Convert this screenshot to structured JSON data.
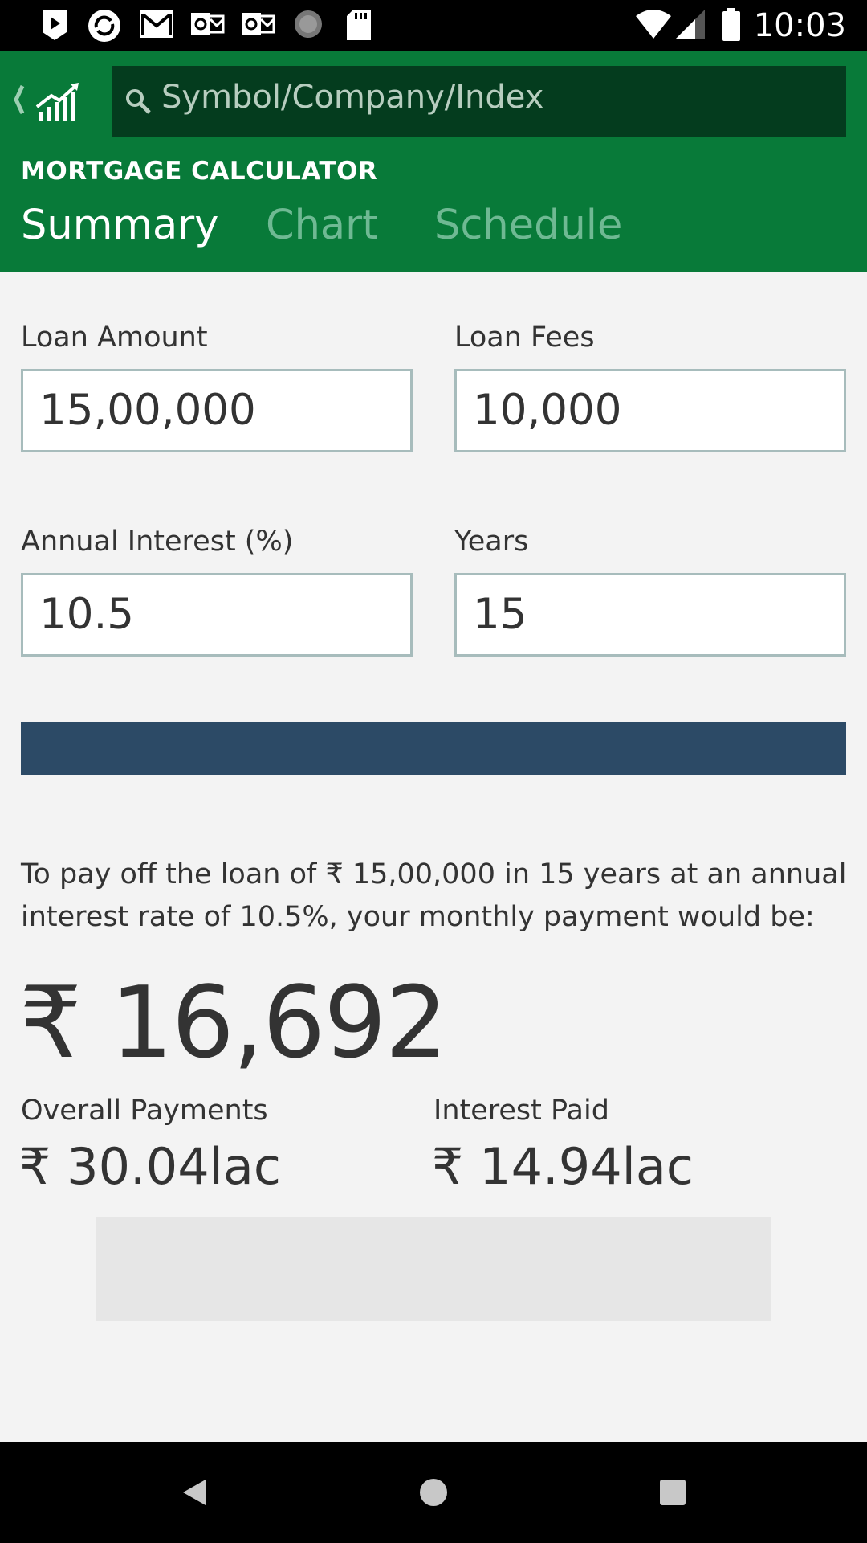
{
  "status_bar": {
    "time": "10:03",
    "icons": [
      "play-store-icon",
      "sync-icon",
      "gmail-icon",
      "outlook-icon",
      "outlook-icon",
      "loading-icon",
      "sd-card-icon",
      "wifi-icon",
      "signal-icon",
      "battery-icon"
    ]
  },
  "header": {
    "search_placeholder": "Symbol/Company/Index",
    "section_title": "MORTGAGE CALCULATOR",
    "tabs": [
      {
        "label": "Summary",
        "active": true
      },
      {
        "label": "Chart",
        "active": false
      },
      {
        "label": "Schedule",
        "active": false
      }
    ]
  },
  "form": {
    "loan_amount": {
      "label": "Loan Amount",
      "value": "15,00,000"
    },
    "loan_fees": {
      "label": "Loan Fees",
      "value": "10,000"
    },
    "annual_interest": {
      "label": "Annual Interest (%)",
      "value": "10.5"
    },
    "years": {
      "label": "Years",
      "value": "15"
    }
  },
  "result": {
    "summary": "To pay off the loan of ₹ 15,00,000 in 15 years at an annual interest rate of 10.5%, your monthly payment would be:",
    "monthly_payment": "₹ 16,692",
    "overall_payments": {
      "label": "Overall Payments",
      "value": "₹ 30.04lac"
    },
    "interest_paid": {
      "label": "Interest Paid",
      "value": "₹ 14.94lac"
    }
  },
  "colors": {
    "header_green": "#087a39",
    "search_dark_green": "#043c1e",
    "button_blue": "#2c4a66",
    "inactive_tab": "#6fb993"
  }
}
